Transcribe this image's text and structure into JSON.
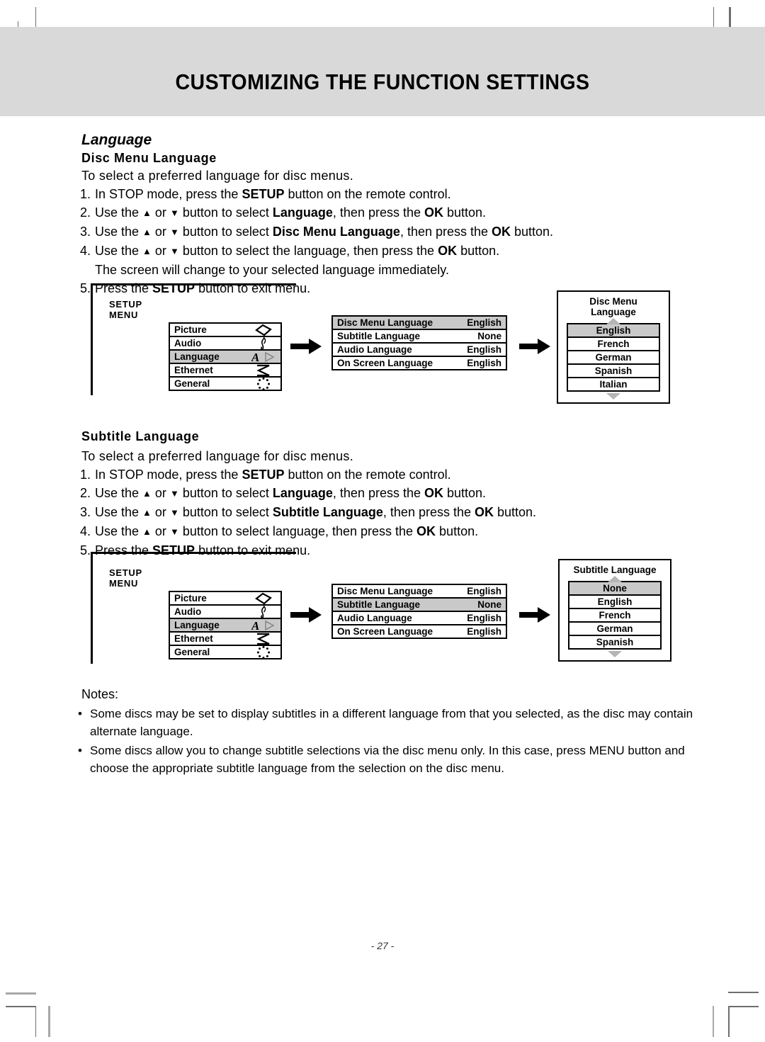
{
  "header": {
    "title": "CUSTOMIZING THE FUNCTION SETTINGS"
  },
  "section": {
    "title": "Language"
  },
  "topics": [
    {
      "heading": "Disc Menu Language",
      "intro": "To select a preferred language for disc menus.",
      "steps": [
        {
          "num": "1.",
          "parts": [
            {
              "t": "In STOP mode, press the ",
              "b": false
            },
            {
              "t": "SETUP",
              "b": true
            },
            {
              "t": " button on the remote control.",
              "b": false
            }
          ]
        },
        {
          "num": "2.",
          "parts": [
            {
              "t": "Use the ",
              "b": false
            },
            {
              "t": "▲",
              "b": false,
              "arrow": true
            },
            {
              "t": " or ",
              "b": false
            },
            {
              "t": "▼",
              "b": false,
              "arrow": true
            },
            {
              "t": " button to select ",
              "b": false
            },
            {
              "t": "Language",
              "b": true
            },
            {
              "t": ", then press the ",
              "b": false
            },
            {
              "t": "OK",
              "b": true
            },
            {
              "t": " button.",
              "b": false
            }
          ]
        },
        {
          "num": "3.",
          "parts": [
            {
              "t": "Use the ",
              "b": false
            },
            {
              "t": "▲",
              "b": false,
              "arrow": true
            },
            {
              "t": " or ",
              "b": false
            },
            {
              "t": "▼",
              "b": false,
              "arrow": true
            },
            {
              "t": " button to select ",
              "b": false
            },
            {
              "t": "Disc Menu Language",
              "b": true
            },
            {
              "t": ", then press the ",
              "b": false
            },
            {
              "t": "OK",
              "b": true
            },
            {
              "t": " button.",
              "b": false
            }
          ]
        },
        {
          "num": "4.",
          "parts": [
            {
              "t": "Use the ",
              "b": false
            },
            {
              "t": "▲",
              "b": false,
              "arrow": true
            },
            {
              "t": " or ",
              "b": false
            },
            {
              "t": "▼",
              "b": false,
              "arrow": true
            },
            {
              "t": " button to select the language, then press the ",
              "b": false
            },
            {
              "t": "OK",
              "b": true
            },
            {
              "t": " button.",
              "b": false
            }
          ]
        },
        {
          "num": "",
          "continuation": "The screen will change to your selected language immediately."
        },
        {
          "num": "5.",
          "parts": [
            {
              "t": "Press the ",
              "b": false
            },
            {
              "t": "SETUP",
              "b": true
            },
            {
              "t": " button to exit menu.",
              "b": false
            }
          ]
        }
      ]
    },
    {
      "heading": "Subtitle Language",
      "intro": "To select a preferred language for disc menus.",
      "steps": [
        {
          "num": "1.",
          "parts": [
            {
              "t": "In STOP mode, press the ",
              "b": false
            },
            {
              "t": "SETUP",
              "b": true
            },
            {
              "t": " button on the remote control.",
              "b": false
            }
          ]
        },
        {
          "num": "2.",
          "parts": [
            {
              "t": "Use the ",
              "b": false
            },
            {
              "t": "▲",
              "b": false,
              "arrow": true
            },
            {
              "t": " or ",
              "b": false
            },
            {
              "t": "▼",
              "b": false,
              "arrow": true
            },
            {
              "t": " button to select ",
              "b": false
            },
            {
              "t": "Language",
              "b": true
            },
            {
              "t": ", then press the ",
              "b": false
            },
            {
              "t": "OK",
              "b": true
            },
            {
              "t": " button.",
              "b": false
            }
          ]
        },
        {
          "num": "3.",
          "parts": [
            {
              "t": "Use the ",
              "b": false
            },
            {
              "t": "▲",
              "b": false,
              "arrow": true
            },
            {
              "t": " or ",
              "b": false
            },
            {
              "t": "▼",
              "b": false,
              "arrow": true
            },
            {
              "t": " button to select ",
              "b": false
            },
            {
              "t": "Subtitle Language",
              "b": true
            },
            {
              "t": ", then press the ",
              "b": false
            },
            {
              "t": "OK",
              "b": true
            },
            {
              "t": " button.",
              "b": false
            }
          ]
        },
        {
          "num": "4.",
          "parts": [
            {
              "t": "Use the ",
              "b": false
            },
            {
              "t": "▲",
              "b": false,
              "arrow": true
            },
            {
              "t": " or ",
              "b": false
            },
            {
              "t": "▼",
              "b": false,
              "arrow": true
            },
            {
              "t": " button to select language, then press the ",
              "b": false
            },
            {
              "t": "OK",
              "b": true
            },
            {
              "t": " button.",
              "b": false
            }
          ]
        },
        {
          "num": "5.",
          "parts": [
            {
              "t": "Press the ",
              "b": false
            },
            {
              "t": "SETUP",
              "b": true
            },
            {
              "t": " button to exit menu.",
              "b": false
            }
          ]
        }
      ]
    }
  ],
  "diagrams": [
    {
      "setup_label": "SETUP MENU",
      "menu_items": [
        {
          "label": "Picture",
          "icon": "diamond-icon",
          "selected": false
        },
        {
          "label": "Audio",
          "icon": "music-note-icon",
          "selected": false
        },
        {
          "label": "Language",
          "icon": "letter-a-play-icon",
          "selected": true
        },
        {
          "label": "Ethernet",
          "icon": "zigzag-icon",
          "selected": false
        },
        {
          "label": "General",
          "icon": "dotted-circle-icon",
          "selected": false
        }
      ],
      "values": [
        {
          "label": "Disc Menu Language",
          "value": "English",
          "selected": true
        },
        {
          "label": "Subtitle Language",
          "value": "None",
          "selected": false
        },
        {
          "label": "Audio Language",
          "value": "English",
          "selected": false
        },
        {
          "label": "On Screen Language",
          "value": "English",
          "selected": false
        }
      ],
      "option_panel": {
        "heading": "Disc Menu Language",
        "options": [
          {
            "label": "English",
            "selected": true
          },
          {
            "label": "French",
            "selected": false
          },
          {
            "label": "German",
            "selected": false
          },
          {
            "label": "Spanish",
            "selected": false
          },
          {
            "label": "Italian",
            "selected": false
          }
        ]
      }
    },
    {
      "setup_label": "SETUP MENU",
      "menu_items": [
        {
          "label": "Picture",
          "icon": "diamond-icon",
          "selected": false
        },
        {
          "label": "Audio",
          "icon": "music-note-icon",
          "selected": false
        },
        {
          "label": "Language",
          "icon": "letter-a-play-icon",
          "selected": true
        },
        {
          "label": "Ethernet",
          "icon": "zigzag-icon",
          "selected": false
        },
        {
          "label": "General",
          "icon": "dotted-circle-icon",
          "selected": false
        }
      ],
      "values": [
        {
          "label": "Disc Menu Language",
          "value": "English",
          "selected": false
        },
        {
          "label": "Subtitle Language",
          "value": "None",
          "selected": true
        },
        {
          "label": "Audio Language",
          "value": "English",
          "selected": false
        },
        {
          "label": "On Screen Language",
          "value": "English",
          "selected": false
        }
      ],
      "option_panel": {
        "heading": "Subtitle Language",
        "options": [
          {
            "label": "None",
            "selected": true
          },
          {
            "label": "English",
            "selected": false
          },
          {
            "label": "French",
            "selected": false
          },
          {
            "label": "German",
            "selected": false
          },
          {
            "label": "Spanish",
            "selected": false
          }
        ]
      }
    }
  ],
  "notes": {
    "label": "Notes:",
    "items": [
      "Some discs may be set to display subtitles in a different language from that you selected, as the disc may contain alternate language.",
      "Some discs allow you to change subtitle selections via the disc menu only. In this case, press MENU button and choose the appropriate subtitle language from the selection on the disc menu."
    ]
  },
  "footer": {
    "page_number": "- 27 -"
  }
}
